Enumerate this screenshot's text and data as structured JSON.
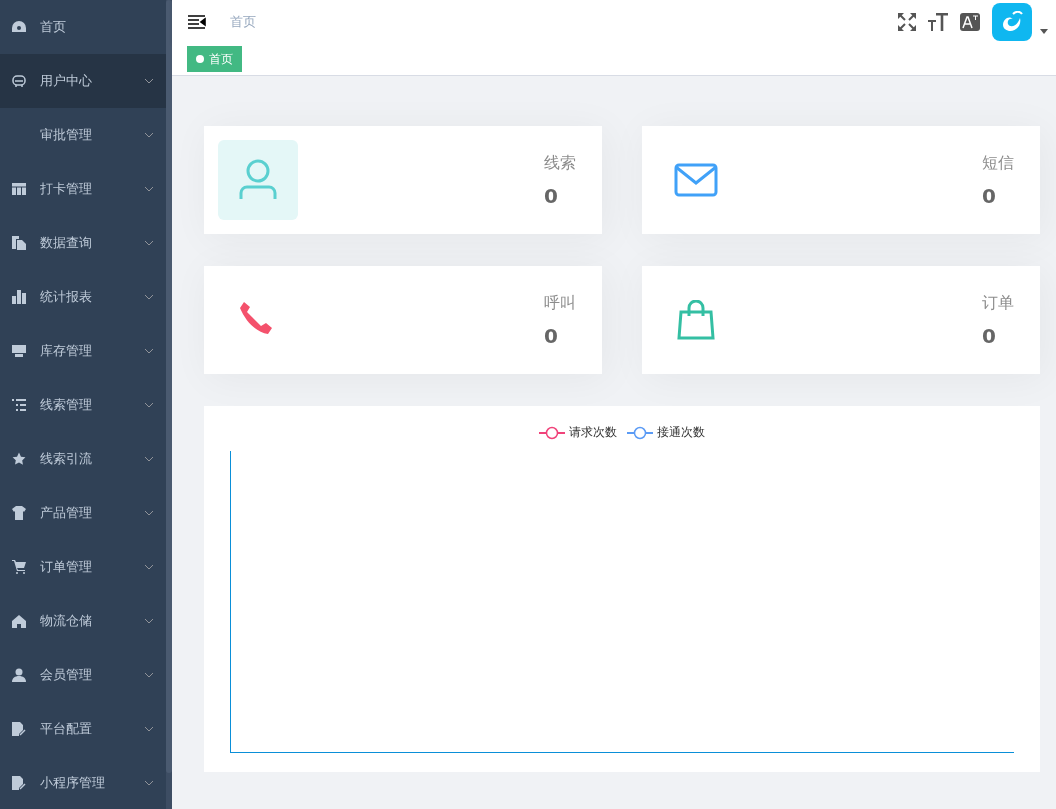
{
  "sidebar": {
    "items": [
      {
        "label": "首页",
        "kind": "link",
        "selected": false
      },
      {
        "label": "用户中心",
        "kind": "submenu",
        "selected": true
      },
      {
        "label": "审批管理",
        "kind": "submenu",
        "selected": false
      },
      {
        "label": "打卡管理",
        "kind": "submenu",
        "selected": false
      },
      {
        "label": "数据查询",
        "kind": "submenu",
        "selected": false
      },
      {
        "label": "统计报表",
        "kind": "submenu",
        "selected": false
      },
      {
        "label": "库存管理",
        "kind": "submenu",
        "selected": false
      },
      {
        "label": "线索管理",
        "kind": "submenu",
        "selected": false
      },
      {
        "label": "线索引流",
        "kind": "submenu",
        "selected": false
      },
      {
        "label": "产品管理",
        "kind": "submenu",
        "selected": false
      },
      {
        "label": "订单管理",
        "kind": "submenu",
        "selected": false
      },
      {
        "label": "物流仓储",
        "kind": "submenu",
        "selected": false
      },
      {
        "label": "会员管理",
        "kind": "submenu",
        "selected": false
      },
      {
        "label": "平台配置",
        "kind": "submenu",
        "selected": false
      },
      {
        "label": "小程序管理",
        "kind": "submenu",
        "selected": false
      }
    ]
  },
  "header": {
    "breadcrumb": "首页"
  },
  "tags": [
    {
      "label": "首页",
      "selected": true
    }
  ],
  "cards": [
    {
      "label": "线索",
      "value": "0",
      "highlighted": true
    },
    {
      "label": "短信",
      "value": "0",
      "highlighted": false
    },
    {
      "label": "呼叫",
      "value": "0",
      "highlighted": false
    },
    {
      "label": "订单",
      "value": "0",
      "highlighted": false
    }
  ],
  "chart": {
    "legend": [
      {
        "name": "请求次数",
        "color": "#f0437a"
      },
      {
        "name": "接通次数",
        "color": "#5b9bf5"
      }
    ]
  }
}
